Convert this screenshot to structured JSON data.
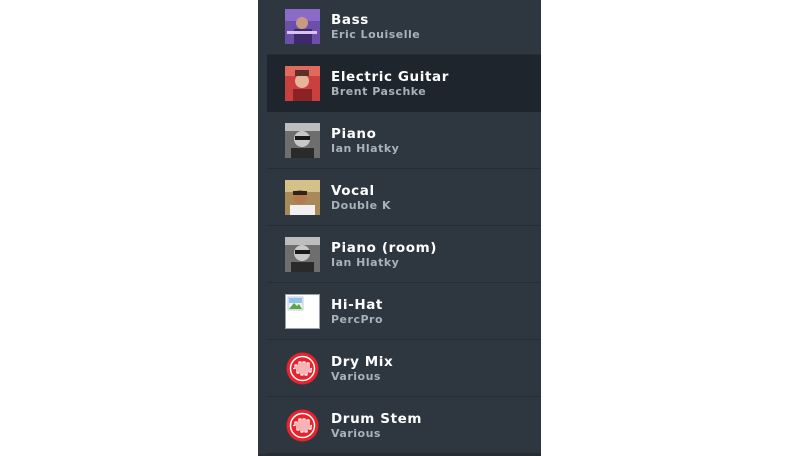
{
  "tracks": [
    {
      "title": "Bass",
      "artist": "Eric Louiselle",
      "thumb": "photo-purple"
    },
    {
      "title": "Electric Guitar",
      "artist": "Brent Paschke",
      "thumb": "photo-red"
    },
    {
      "title": "Piano",
      "artist": "Ian Hlatky",
      "thumb": "photo-bw"
    },
    {
      "title": "Vocal",
      "artist": "Double K",
      "thumb": "photo-warm"
    },
    {
      "title": "Piano (room)",
      "artist": "Ian Hlatky",
      "thumb": "photo-bw"
    },
    {
      "title": "Hi-Hat",
      "artist": "PercPro",
      "thumb": "broken-image-icon"
    },
    {
      "title": "Dry Mix",
      "artist": "Various",
      "thumb": "waveform-logo-icon"
    },
    {
      "title": "Drum Stem",
      "artist": "Various",
      "thumb": "waveform-logo-icon"
    }
  ],
  "selected_index": 1,
  "colors": {
    "panel": "#2e3740",
    "selected": "#1e252c",
    "logo_red": "#e8232c"
  }
}
